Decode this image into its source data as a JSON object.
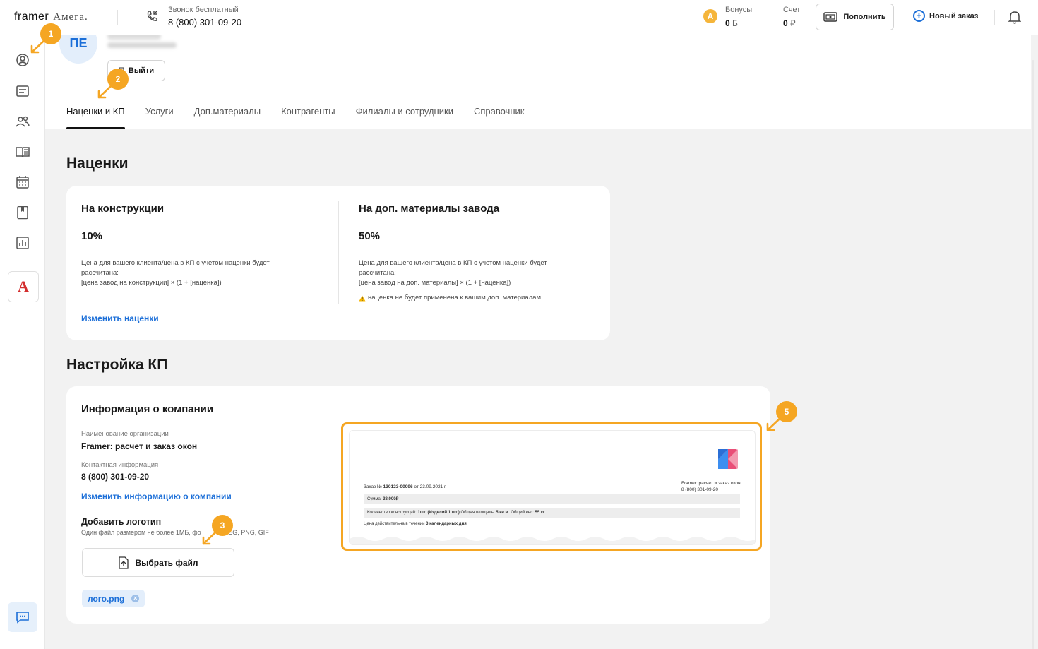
{
  "topbar": {
    "logo_framer": "framer",
    "logo_amega": "Амега.",
    "hotline_label": "Звонок бесплатный",
    "hotline_number": "8 (800) 301-09-20",
    "bonus_label": "Бонусы",
    "bonus_value": "0",
    "bonus_unit": "Б",
    "account_label": "Счет",
    "account_value": "0",
    "account_unit": "₽",
    "topup_label": "Пополнить",
    "new_order_label": "Новый заказ"
  },
  "sidebar": {
    "brand_letter": "A",
    "items": [
      "profile-icon",
      "orders-icon",
      "clients-icon",
      "catalog-icon",
      "calendar-icon",
      "bookmark-icon",
      "reports-icon"
    ]
  },
  "profile": {
    "initials": "ПЕ",
    "logout_label": "Выйти"
  },
  "tabs": [
    {
      "label": "Наценки и КП"
    },
    {
      "label": "Услуги"
    },
    {
      "label": "Доп.материалы"
    },
    {
      "label": "Контрагенты"
    },
    {
      "label": "Филиалы и сотрудники"
    },
    {
      "label": "Справочник"
    }
  ],
  "markups": {
    "heading": "Наценки",
    "construction": {
      "title": "На конструкции",
      "percent": "10%",
      "note1": "Цена для вашего клиента/цена в КП с учетом наценки будет",
      "note2": "рассчитана:",
      "note3": "[цена завод на  конструкции] × (1 + [наценка])"
    },
    "materials": {
      "title": "На доп. материалы завода",
      "percent": "50%",
      "note1": "Цена для вашего клиента/цена в КП с учетом наценки будет",
      "note2": "рассчитана:",
      "note3": "[цена завод на доп. материалы] × (1 + [наценка])",
      "warning": "наценка не будет применена к вашим доп. материалам"
    },
    "change_link": "Изменить наценки"
  },
  "kp": {
    "heading": "Настройка КП",
    "company_title": "Информация о компании",
    "org_label": "Наименование организации",
    "org_value": "Framer: расчет и заказ окон",
    "contact_label": "Контактная информация",
    "contact_value": "8 (800) 301-09-20",
    "change_link": "Изменить информацию о компании",
    "logo_title": "Добавить логотип",
    "logo_hint_a": "Один файл размером не более 1МБ, фо",
    "logo_hint_b": "JPEG, PNG, GIF",
    "choose_file": "Выбрать файл",
    "file_name": "лого.png"
  },
  "preview": {
    "order_prefix": "Заказ № ",
    "order_no": "130123-00096",
    "order_date": " от 23.09.2021 г.",
    "company": "Framer: расчет и заказ окон",
    "phone": "8 (800) 301-09-20",
    "sum_label": "Сумма: ",
    "sum_value": "38.000₽",
    "details_a": "Количество конструкций: ",
    "details_b": "1шт. (Изделий 1 шт.)",
    "details_c": "  Общая площадь: ",
    "details_d": "5 кв.м.",
    "details_e": "  Общий вес: ",
    "details_f": "55 кг.",
    "valid_a": "Цена действительна в течении ",
    "valid_b": "3 календарных дня"
  },
  "callouts": [
    "1",
    "2",
    "3",
    "5"
  ],
  "colors": {
    "accent": "#1c6fd8",
    "callout": "#f5a623",
    "bonus": "#f5b53a"
  }
}
